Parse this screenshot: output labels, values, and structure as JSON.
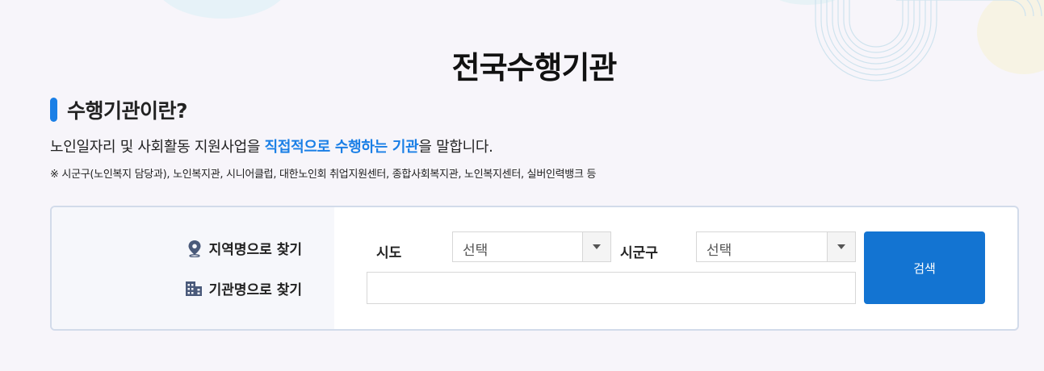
{
  "page": {
    "title": "전국수행기관"
  },
  "section": {
    "title": "수행기관이란?",
    "desc_before": "노인일자리 및 사회활동 지원사업을 ",
    "desc_highlight": "직접적으로 수행하는 기관",
    "desc_after": "을 말합니다.",
    "note": "※ 시군구(노인복지 담당과), 노인복지관, 시니어클럽, 대한노인회 취업지원센터, 종합사회복지관, 노인복지센터, 실버인력뱅크 등"
  },
  "search": {
    "find_by_region": "지역명으로 찾기",
    "find_by_agency": "기관명으로 찾기",
    "sido_label": "시도",
    "sido_value": "선택",
    "sigungu_label": "시군구",
    "sigungu_value": "선택",
    "agency_input_value": "",
    "button_label": "검색"
  },
  "colors": {
    "accent": "#1a7fe6",
    "button": "#1374d2",
    "background": "#f7f5fa"
  },
  "icons": {
    "region": "location-pin-icon",
    "agency": "building-icon",
    "select_arrow": "caret-down-icon"
  }
}
